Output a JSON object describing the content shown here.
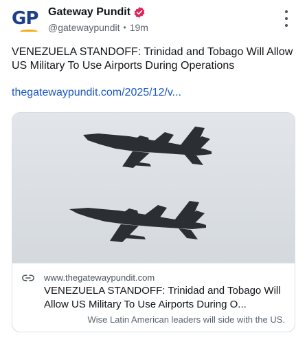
{
  "author": {
    "display_name": "Gateway Pundit",
    "handle": "@gatewaypundit",
    "time": "19m",
    "avatar_text": "GP",
    "verified_color": "#e0245e"
  },
  "post": {
    "text": "VENEZUELA STANDOFF: Trinidad and Tobago Will Allow US Military To Use Airports During Operations",
    "link": "thegatewaypundit.com/2025/12/v..."
  },
  "card": {
    "domain": "www.thegatewaypundit.com",
    "title": "VENEZUELA STANDOFF: Trinidad and Tobago Will Allow US Military To Use Airports During O...",
    "description": "Wise Latin American leaders will side with the US.",
    "image_subject": "two fighter jets in flight"
  },
  "icons": {
    "menu": "more-vertical-icon",
    "link": "link-icon",
    "verified": "verified-badge-icon"
  },
  "colors": {
    "link": "#1a55c4",
    "brand_blue": "#1d3e88",
    "brand_gold": "#f2a90b"
  }
}
